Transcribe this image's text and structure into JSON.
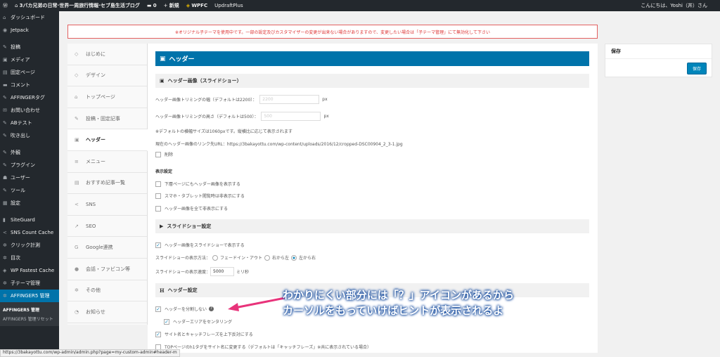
{
  "adminbar": {
    "site": "3バカ兄弟の日常·世界一周旅行情報·セブ島生活ブログ",
    "comments": "0",
    "new": "新規",
    "wpfc": "WPFC",
    "updraft": "UpdraftPlus",
    "greeting": "こんにちは、Yoshi（丼）さん"
  },
  "sidebar": {
    "items": [
      {
        "icon": "⌂",
        "label": "ダッシュボード"
      },
      {
        "icon": "◉",
        "label": "Jetpack"
      },
      {
        "gap": true
      },
      {
        "icon": "✎",
        "label": "投稿"
      },
      {
        "icon": "▣",
        "label": "メディア"
      },
      {
        "icon": "▤",
        "label": "固定ページ"
      },
      {
        "icon": "▬",
        "label": "コメント"
      },
      {
        "icon": "✎",
        "label": "AFFINGERタグ"
      },
      {
        "icon": "✉",
        "label": "お問い合わせ"
      },
      {
        "icon": "✎",
        "label": "ABテスト"
      },
      {
        "icon": "✎",
        "label": "吹き出し"
      },
      {
        "gap": true
      },
      {
        "icon": "✎",
        "label": "外観"
      },
      {
        "icon": "✎",
        "label": "プラグイン"
      },
      {
        "icon": "☗",
        "label": "ユーザー"
      },
      {
        "icon": "✎",
        "label": "ツール"
      },
      {
        "icon": "▦",
        "label": "設定"
      },
      {
        "gap": true
      },
      {
        "icon": "▮",
        "label": "SiteGuard"
      },
      {
        "icon": "<",
        "label": "SNS Count Cache"
      },
      {
        "icon": "✲",
        "label": "クリック計測"
      },
      {
        "icon": "✲",
        "label": "目次"
      },
      {
        "icon": "◈",
        "label": "WP Fastest Cache"
      },
      {
        "icon": "✲",
        "label": "子テーマ管理"
      },
      {
        "icon": "✲",
        "label": "AFFINGER5 管理",
        "active": true
      }
    ],
    "sub": [
      "AFFINGER5 管理",
      "AFFINGER5 管理リセット"
    ]
  },
  "notice": "※オリジナル子テーマを使用中です。一部の設定及びカスタマイザーの変更が出来ない場合がありますので、変更したい場合は「子テーマ管理」にて無効化して下さい",
  "nav": [
    {
      "icon": "◇",
      "label": "はじめに"
    },
    {
      "icon": "◇",
      "label": "デザイン"
    },
    {
      "icon": "⌂",
      "label": "トップページ"
    },
    {
      "icon": "✎",
      "label": "投稿・固定記事"
    },
    {
      "icon": "▣",
      "label": "ヘッダー",
      "active": true
    },
    {
      "icon": "≡",
      "label": "メニュー"
    },
    {
      "icon": "▤",
      "label": "おすすめ記事一覧"
    },
    {
      "icon": "<",
      "label": "SNS"
    },
    {
      "icon": "↗",
      "label": "SEO"
    },
    {
      "icon": "G",
      "label": "Google連携"
    },
    {
      "icon": "●",
      "label": "会話・ファビコン等"
    },
    {
      "icon": "✲",
      "label": "その他"
    },
    {
      "icon": "◔",
      "label": "お知らせ"
    }
  ],
  "main": {
    "title": "ヘッダー",
    "sec1": "ヘッダー画像（スライドショー）",
    "width_label": "ヘッダー画像トリミングの幅（デフォルトは2200）：",
    "width_val": "2200",
    "px": "px",
    "height_label": "ヘッダー画像トリミングの高さ（デフォルトは500）：",
    "height_val": "500",
    "note": "※デフォルトの横幅サイズは1060pxです。縦横比に応じて表示されます",
    "url": "現在のヘッダー画像のリンク先URL：https://3bakayottu.com/wp-content/uploads/2016/12/cropped-DSC00904_2_3-1.jpg",
    "delete": "削除",
    "display": "表示設定",
    "d1": "下層ページにもヘッダー画像を表示する",
    "d2": "スマホ・タブレット閲覧時は非表示にする",
    "d3": "ヘッダー画像を全て非表示にする",
    "sec2": "スライドショー設定",
    "s1": "ヘッダー画像をスライドショーで表示する",
    "method": "スライドショーの表示方法：",
    "fade": "フェードイン・アウト",
    "rtl": "右から左",
    "ltr": "左から右",
    "speed": "スライドショーの表示速度：",
    "speed_val": "5000",
    "ms": "ミリ秒",
    "sec3": "ヘッダー設定",
    "h1": "ヘッダーを分割しない",
    "h2": "ヘッダーエリアをセンタリング",
    "h3": "サイト名とキャッチフレーズを上下反対にする",
    "h4": "TOPページのh1タグをサイト名に変更する（デフォルトは「キャッチフレーズ」※共に表示されている場合）"
  },
  "side": {
    "title": "保存",
    "button": "保存"
  },
  "annotation": {
    "line1": "わかりにくい部分には「？」アイコンがあるから",
    "line2": "カーソルをもっていけばヒントが表示されるよ"
  },
  "status": "https://3bakayottu.com/wp-admin/admin.php?page=my-custom-admin#header-m"
}
